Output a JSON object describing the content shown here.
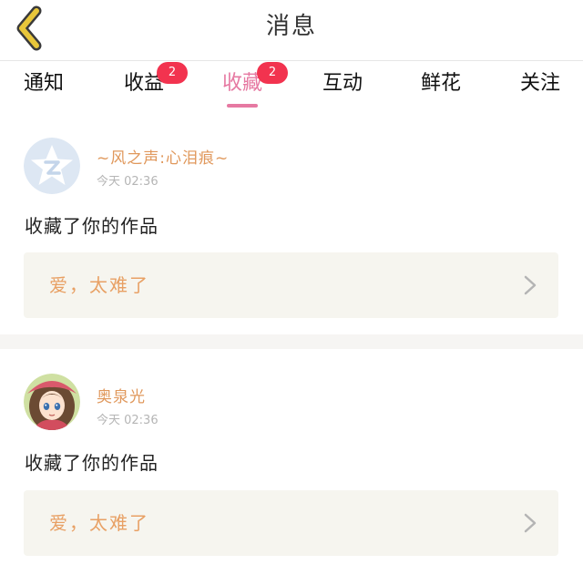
{
  "header": {
    "title": "消息",
    "back_icon": "chevron-left-icon"
  },
  "tabs": [
    {
      "label": "通知",
      "badge": "",
      "active": false
    },
    {
      "label": "收益",
      "badge": "2",
      "active": false
    },
    {
      "label": "收藏",
      "badge": "2",
      "active": true
    },
    {
      "label": "互动",
      "badge": "",
      "active": false
    },
    {
      "label": "鲜花",
      "badge": "",
      "active": false
    },
    {
      "label": "关注",
      "badge": "",
      "active": false
    }
  ],
  "notifications": [
    {
      "user_name": "~风之声:心泪痕~",
      "time": "今天 02:36",
      "action": "收藏了你的作品",
      "work_title": "爱，太难了",
      "avatar": "qq-default-avatar-icon"
    },
    {
      "user_name": "奥泉光",
      "time": "今天 02:36",
      "action": "收藏了你的作品",
      "work_title": "爱，太难了",
      "avatar": "anime-girl-avatar"
    }
  ],
  "colors": {
    "accent": "#e679a2",
    "badge": "#f2334f",
    "back_icon": "#e8c63a",
    "username": "#e0985c",
    "work_title": "#e8a064",
    "card_bg": "#f6f5ef"
  }
}
